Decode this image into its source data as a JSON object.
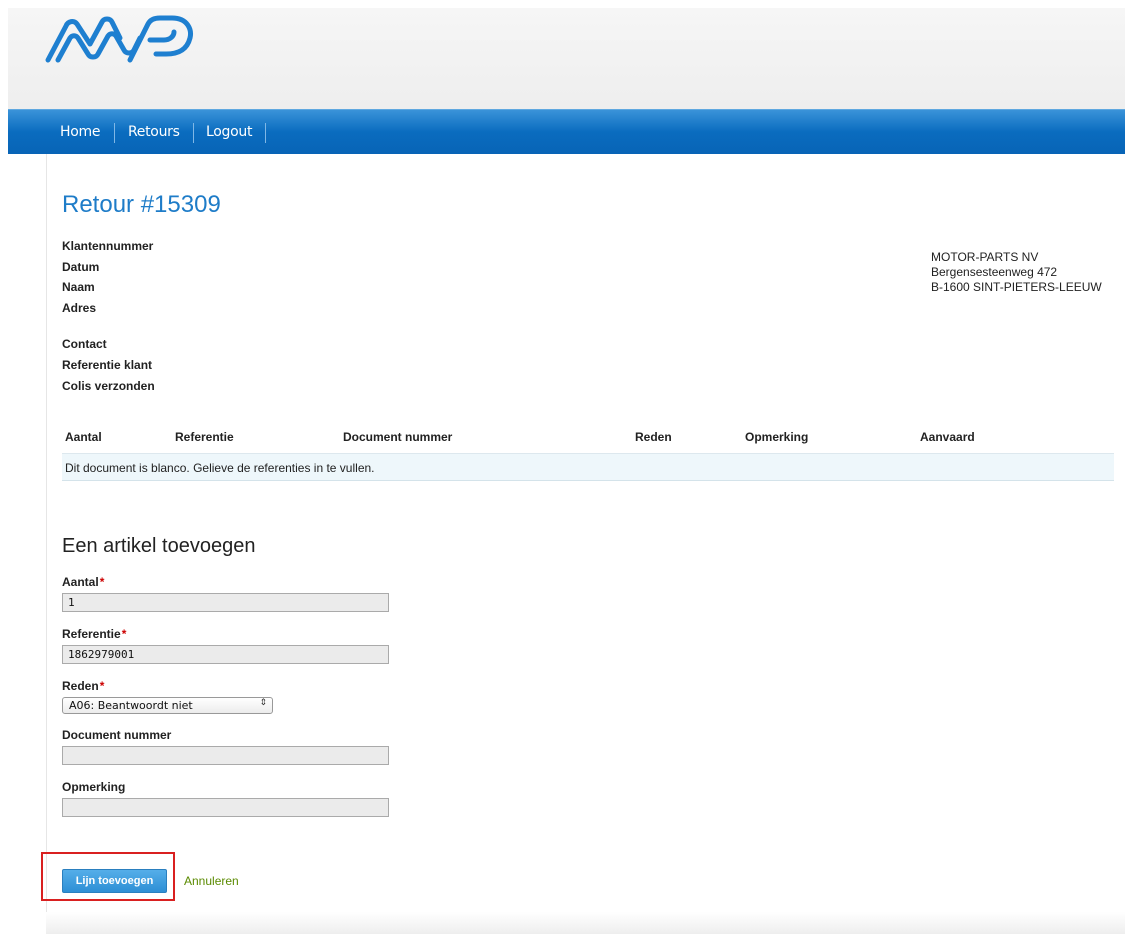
{
  "nav": {
    "items": [
      "Home",
      "Retours",
      "Logout"
    ]
  },
  "page": {
    "title": "Retour #15309"
  },
  "info": {
    "labels": [
      "Klantennummer",
      "Datum",
      "Naam",
      "Adres",
      "Contact",
      "Referentie klant",
      "Colis verzonden"
    ]
  },
  "company": {
    "name": "MOTOR-PARTS NV",
    "street": "Bergensesteenweg 472",
    "city": "B-1600 SINT-PIETERS-LEEUW"
  },
  "table": {
    "headers": [
      "Aantal",
      "Referentie",
      "Document nummer",
      "Reden",
      "Opmerking",
      "Aanvaard"
    ],
    "empty_message": "Dit document is blanco. Gelieve de referenties in te vullen."
  },
  "form": {
    "title": "Een artikel toevoegen",
    "required_mark": "*",
    "aantal_label": "Aantal",
    "aantal_value": "1",
    "referentie_label": "Referentie",
    "referentie_value": "1862979001",
    "reden_label": "Reden",
    "reden_value": "A06: Beantwoordt niet",
    "document_label": "Document nummer",
    "document_value": "",
    "opmerking_label": "Opmerking",
    "opmerking_value": "",
    "submit_label": "Lijn toevoegen",
    "cancel_label": "Annuleren"
  },
  "icons": {
    "logo": "mp-logo",
    "select_arrow": "updown-arrow-icon"
  },
  "colors": {
    "nav_blue": "#0a6cbf",
    "title_blue": "#1e7cc8",
    "button_blue": "#2d8fd5",
    "cancel_green": "#5a8a00",
    "required_red": "#cc0000",
    "highlight_red": "#d92020"
  }
}
